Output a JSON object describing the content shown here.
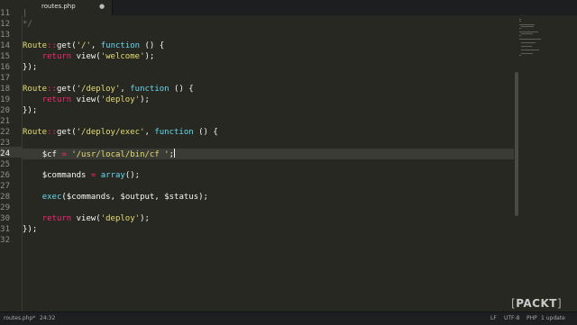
{
  "tab": {
    "title": "routes.php",
    "close_icon": "close-dot-icon"
  },
  "gutter": {
    "line_numbers": [
      "11",
      "12",
      "13",
      "14",
      "15",
      "16",
      "17",
      "18",
      "19",
      "20",
      "21",
      "22",
      "23",
      "24",
      "25",
      "26",
      "27",
      "28",
      "29",
      "30",
      "31",
      "32"
    ],
    "current_line": "24"
  },
  "code_lines": [
    [
      {
        "t": "|",
        "c": "comment"
      }
    ],
    [
      {
        "t": "*/",
        "c": "comment"
      }
    ],
    [],
    [
      {
        "t": "Route",
        "c": "yellow"
      },
      {
        "t": "::",
        "c": "pink"
      },
      {
        "t": "get(",
        "c": "plain"
      },
      {
        "t": "'/'",
        "c": "yellow"
      },
      {
        "t": ", ",
        "c": "plain"
      },
      {
        "t": "function",
        "c": "blue"
      },
      {
        "t": " () {",
        "c": "plain"
      }
    ],
    [
      {
        "t": "    ",
        "c": "plain"
      },
      {
        "t": "return",
        "c": "pink"
      },
      {
        "t": " view(",
        "c": "plain"
      },
      {
        "t": "'welcome'",
        "c": "yellow"
      },
      {
        "t": ");",
        "c": "plain"
      }
    ],
    [
      {
        "t": "});",
        "c": "plain"
      }
    ],
    [],
    [
      {
        "t": "Route",
        "c": "yellow"
      },
      {
        "t": "::",
        "c": "pink"
      },
      {
        "t": "get(",
        "c": "plain"
      },
      {
        "t": "'/deploy'",
        "c": "yellow"
      },
      {
        "t": ", ",
        "c": "plain"
      },
      {
        "t": "function",
        "c": "blue"
      },
      {
        "t": " () {",
        "c": "plain"
      }
    ],
    [
      {
        "t": "    ",
        "c": "plain"
      },
      {
        "t": "return",
        "c": "pink"
      },
      {
        "t": " view(",
        "c": "plain"
      },
      {
        "t": "'deploy'",
        "c": "yellow"
      },
      {
        "t": ");",
        "c": "plain"
      }
    ],
    [
      {
        "t": "});",
        "c": "plain"
      }
    ],
    [],
    [
      {
        "t": "Route",
        "c": "yellow"
      },
      {
        "t": "::",
        "c": "pink"
      },
      {
        "t": "get(",
        "c": "plain"
      },
      {
        "t": "'/deploy/exec'",
        "c": "yellow"
      },
      {
        "t": ", ",
        "c": "plain"
      },
      {
        "t": "function",
        "c": "blue"
      },
      {
        "t": " () {",
        "c": "plain"
      }
    ],
    [],
    [
      {
        "t": "    ",
        "c": "plain"
      },
      {
        "t": "$cf",
        "c": "plain"
      },
      {
        "t": " = ",
        "c": "pink"
      },
      {
        "t": "'/usr/local/bin/cf '",
        "c": "yellow"
      },
      {
        "t": ";",
        "c": "plain"
      },
      {
        "t": "",
        "c": "caret"
      }
    ],
    [],
    [
      {
        "t": "    ",
        "c": "plain"
      },
      {
        "t": "$commands",
        "c": "plain"
      },
      {
        "t": " = ",
        "c": "pink"
      },
      {
        "t": "array",
        "c": "blue"
      },
      {
        "t": "();",
        "c": "plain"
      }
    ],
    [],
    [
      {
        "t": "    ",
        "c": "plain"
      },
      {
        "t": "exec",
        "c": "blue"
      },
      {
        "t": "(",
        "c": "plain"
      },
      {
        "t": "$commands",
        "c": "plain"
      },
      {
        "t": ", ",
        "c": "plain"
      },
      {
        "t": "$output",
        "c": "plain"
      },
      {
        "t": ", ",
        "c": "plain"
      },
      {
        "t": "$status",
        "c": "plain"
      },
      {
        "t": ");",
        "c": "plain"
      }
    ],
    [],
    [
      {
        "t": "    ",
        "c": "plain"
      },
      {
        "t": "return",
        "c": "pink"
      },
      {
        "t": " view(",
        "c": "plain"
      },
      {
        "t": "'deploy'",
        "c": "yellow"
      },
      {
        "t": ");",
        "c": "plain"
      }
    ],
    [
      {
        "t": "});",
        "c": "plain"
      }
    ],
    []
  ],
  "statusbar": {
    "file": "routes.php*",
    "position": "24:32",
    "line_ending": "LF",
    "encoding": "UTF-8",
    "grammar": "PHP",
    "updates": "1 update"
  },
  "watermark": {
    "text": "PACKT"
  },
  "colors": {
    "background": "#272822",
    "string": "#e6db74",
    "keyword": "#f92672",
    "function": "#66d9ef"
  }
}
